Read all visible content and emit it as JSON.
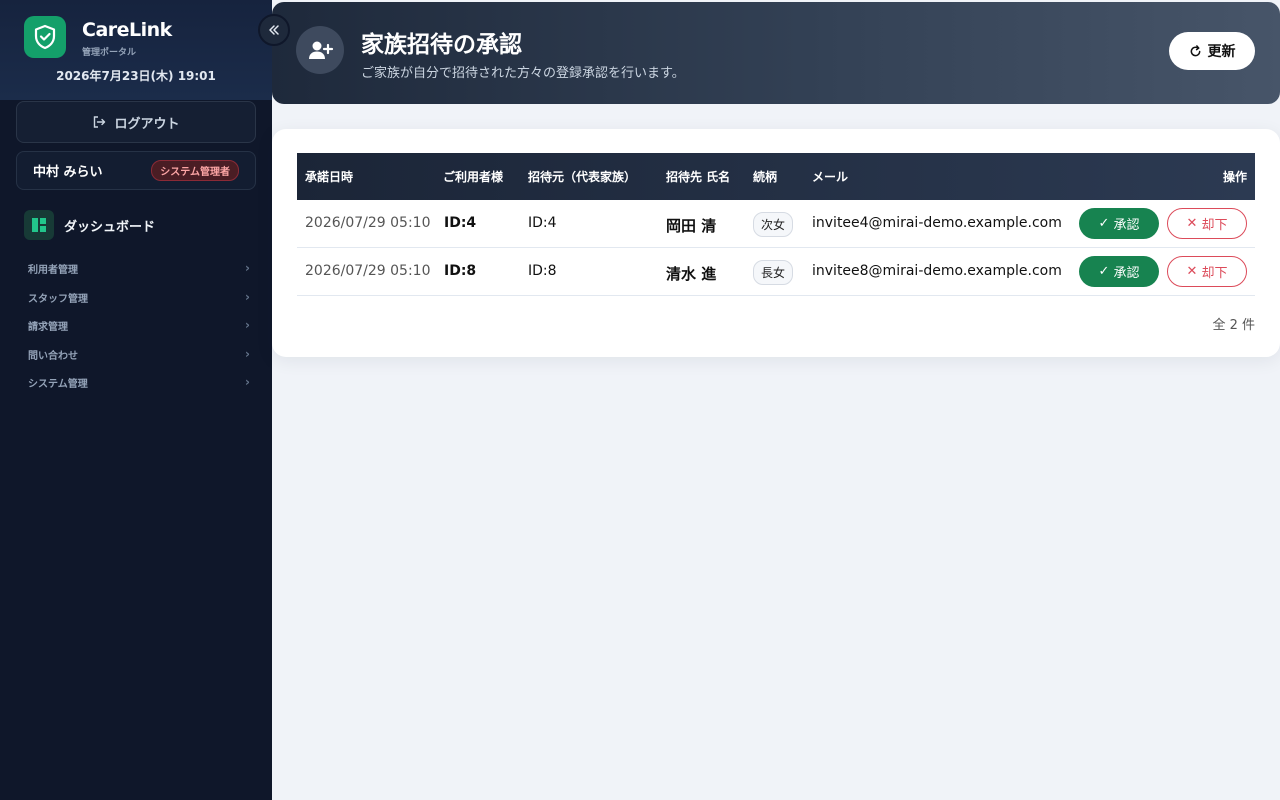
{
  "brand": {
    "name": "CareLink",
    "subtitle": "管理ポータル",
    "datetime": "2026年7月23日(木) 19:01",
    "accent": "#14a06a"
  },
  "sidebar": {
    "logout_label": "ログアウト",
    "user_name": "中村 みらい",
    "role": "システム管理者",
    "dashboard_label": "ダッシュボード",
    "groups": [
      {
        "label": "利用者管理"
      },
      {
        "label": "スタッフ管理"
      },
      {
        "label": "請求管理"
      },
      {
        "label": "問い合わせ"
      },
      {
        "label": "システム管理"
      }
    ]
  },
  "header": {
    "title": "家族招待の承認",
    "subtitle": "ご家族が自分で招待された方々の登録承認を行います。",
    "refresh_label": "更新"
  },
  "table": {
    "columns": [
      "承諾日時",
      "ご利用者様",
      "招待元（代表家族）",
      "招待先 氏名",
      "続柄",
      "メール",
      "操作"
    ],
    "rows": [
      {
        "date": "2026/07/29 05:10",
        "user": "ID:4",
        "inviter": "ID:4",
        "name": "岡田 清",
        "relation": "次女",
        "email": "invitee4@mirai-demo.example.com",
        "approve": "承認",
        "reject": "却下"
      },
      {
        "date": "2026/07/29 05:10",
        "user": "ID:8",
        "inviter": "ID:8",
        "name": "清水 進",
        "relation": "長女",
        "email": "invitee8@mirai-demo.example.com",
        "approve": "承認",
        "reject": "却下"
      }
    ],
    "total": "全 2 件"
  },
  "colors": {
    "approve": "#178350",
    "reject": "#dc4b5a",
    "sidebar_bg": "#0f172a"
  }
}
